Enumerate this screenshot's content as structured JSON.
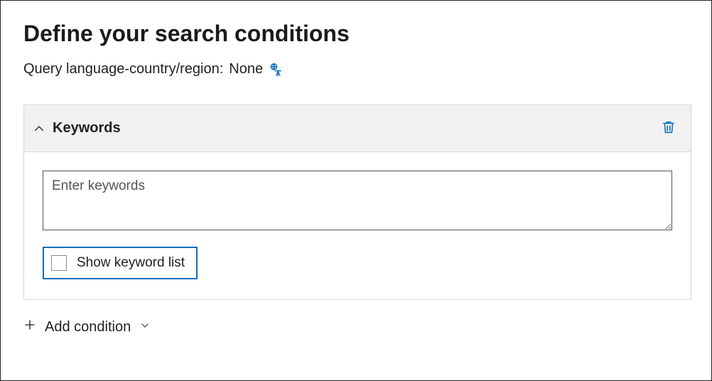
{
  "page": {
    "title": "Define your search conditions",
    "query_language_label": "Query language-country/region:",
    "query_language_value": "None"
  },
  "keywords_card": {
    "title": "Keywords",
    "collapse_icon": "chevron-up-icon",
    "delete_icon": "trash-icon",
    "textarea_placeholder": "Enter keywords",
    "textarea_value": "",
    "show_keyword_list_label": "Show keyword list",
    "show_keyword_list_checked": false
  },
  "actions": {
    "add_condition_label": "Add condition"
  },
  "icons": {
    "language": "globe-translate-icon",
    "plus": "plus-icon",
    "caret": "chevron-down-icon"
  },
  "colors": {
    "accent": "#0f6cbd",
    "card_header_bg": "#f1f1f1",
    "border": "#d6d6d6"
  }
}
